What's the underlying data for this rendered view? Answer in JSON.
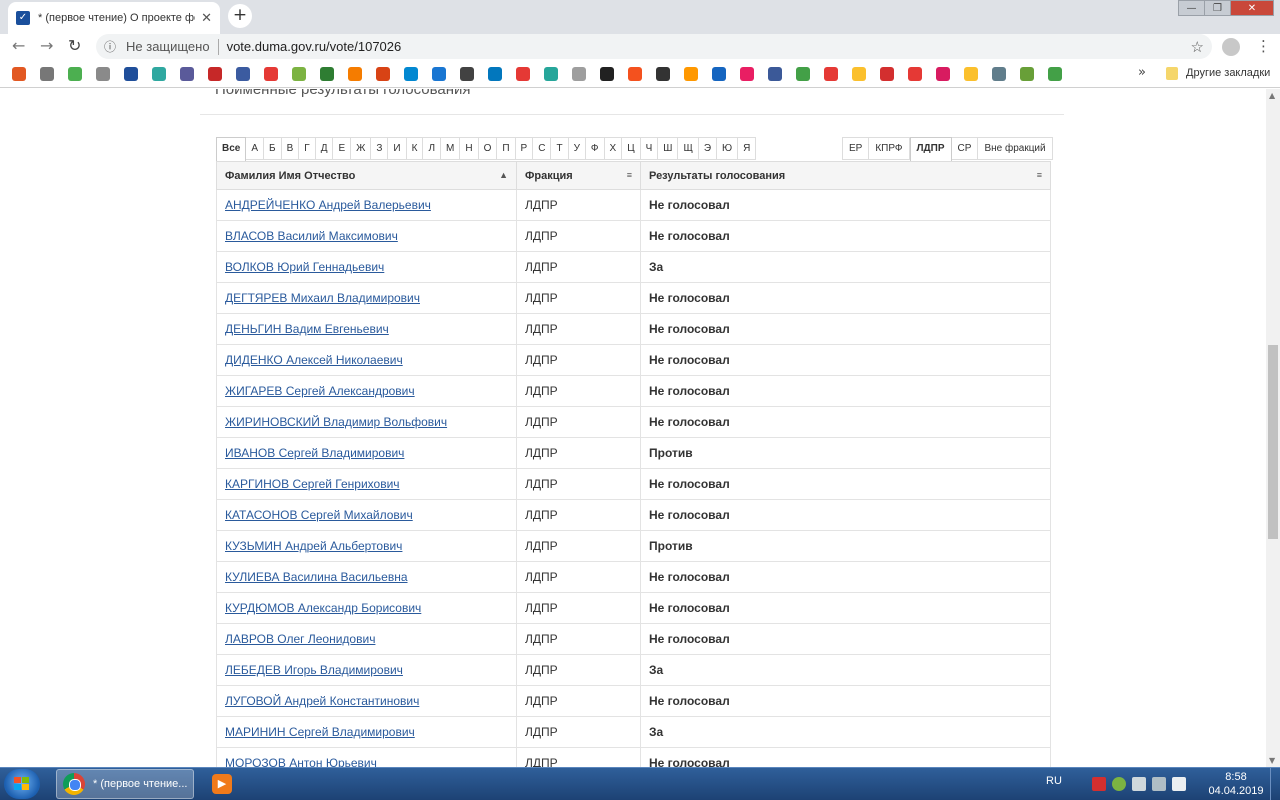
{
  "browser": {
    "tab_title": "* (первое чтение) О проекте фе",
    "tab_close": "✕",
    "new_tab": "+",
    "security_label": "Не защищено",
    "url": "vote.duma.gov.ru/vote/107026",
    "bookmarks_more": "»",
    "other_bookmarks": "Другие закладки",
    "bookmark_colors": [
      "#e25822",
      "#777777",
      "#4caf50",
      "#8a8a8a",
      "#1f4e9a",
      "#2fa8a0",
      "#5a5a9a",
      "#c62828",
      "#3b5ba0",
      "#e53935",
      "#7cb342",
      "#2e7d32",
      "#f57c00",
      "#d84315",
      "#0288d1",
      "#1976d2",
      "#424242",
      "#0277bd",
      "#e53935",
      "#26a69a",
      "#9e9e9e",
      "#212121",
      "#f4511e",
      "#333333",
      "#ff9800",
      "#1565c0",
      "#e91e63",
      "#3b5998",
      "#43a047",
      "#e53935",
      "#fbc02d",
      "#d32f2f",
      "#e53935",
      "#d81b60",
      "#fbc02d",
      "#607d8b",
      "#689f38",
      "#43a047"
    ]
  },
  "page": {
    "section_title": "Поименные результаты голосования",
    "letters": [
      "Все",
      "А",
      "Б",
      "В",
      "Г",
      "Д",
      "Е",
      "Ж",
      "З",
      "И",
      "К",
      "Л",
      "М",
      "Н",
      "О",
      "П",
      "Р",
      "С",
      "Т",
      "У",
      "Ф",
      "Х",
      "Ц",
      "Ч",
      "Ш",
      "Щ",
      "Э",
      "Ю",
      "Я"
    ],
    "active_letter": "Все",
    "factions": [
      "ЕР",
      "КПРФ",
      "ЛДПР",
      "СР",
      "Вне фракций"
    ],
    "active_faction": "ЛДПР",
    "table": {
      "headers": [
        "Фамилия Имя Отчество",
        "Фракция",
        "Результаты голосования"
      ],
      "sort_icon": "▲",
      "menu_icon": "≡",
      "rows": [
        {
          "name": "АНДРЕЙЧЕНКО Андрей Валерьевич",
          "faction": "ЛДПР",
          "vote": "Не голосовал",
          "kind": "none"
        },
        {
          "name": "ВЛАСОВ Василий Максимович",
          "faction": "ЛДПР",
          "vote": "Не голосовал",
          "kind": "none"
        },
        {
          "name": "ВОЛКОВ Юрий Геннадьевич",
          "faction": "ЛДПР",
          "vote": "За",
          "kind": "za"
        },
        {
          "name": "ДЕГТЯРЕВ Михаил Владимирович",
          "faction": "ЛДПР",
          "vote": "Не голосовал",
          "kind": "none"
        },
        {
          "name": "ДЕНЬГИН Вадим Евгеньевич",
          "faction": "ЛДПР",
          "vote": "Не голосовал",
          "kind": "none"
        },
        {
          "name": "ДИДЕНКО Алексей Николаевич",
          "faction": "ЛДПР",
          "vote": "Не голосовал",
          "kind": "none"
        },
        {
          "name": "ЖИГАРЕВ Сергей Александрович",
          "faction": "ЛДПР",
          "vote": "Не голосовал",
          "kind": "none"
        },
        {
          "name": "ЖИРИНОВСКИЙ Владимир Вольфович",
          "faction": "ЛДПР",
          "vote": "Не голосовал",
          "kind": "none"
        },
        {
          "name": "ИВАНОВ Сергей Владимирович",
          "faction": "ЛДПР",
          "vote": "Против",
          "kind": "protiv"
        },
        {
          "name": "КАРГИНОВ Сергей Генрихович",
          "faction": "ЛДПР",
          "vote": "Не голосовал",
          "kind": "none"
        },
        {
          "name": "КАТАСОНОВ Сергей Михайлович",
          "faction": "ЛДПР",
          "vote": "Не голосовал",
          "kind": "none"
        },
        {
          "name": "КУЗЬМИН Андрей Альбертович",
          "faction": "ЛДПР",
          "vote": "Против",
          "kind": "protiv"
        },
        {
          "name": "КУЛИЕВА Василина Васильевна",
          "faction": "ЛДПР",
          "vote": "Не голосовал",
          "kind": "none"
        },
        {
          "name": "КУРДЮМОВ Александр Борисович",
          "faction": "ЛДПР",
          "vote": "Не голосовал",
          "kind": "none"
        },
        {
          "name": "ЛАВРОВ Олег Леонидович",
          "faction": "ЛДПР",
          "vote": "Не голосовал",
          "kind": "none"
        },
        {
          "name": "ЛЕБЕДЕВ Игорь Владимирович",
          "faction": "ЛДПР",
          "vote": "За",
          "kind": "za"
        },
        {
          "name": "ЛУГОВОЙ Андрей Константинович",
          "faction": "ЛДПР",
          "vote": "Не голосовал",
          "kind": "none"
        },
        {
          "name": "МАРИНИН Сергей Владимирович",
          "faction": "ЛДПР",
          "vote": "За",
          "kind": "za"
        },
        {
          "name": "МОРОЗОВ Антон Юрьевич",
          "faction": "ЛДПР",
          "vote": "Не голосовал",
          "kind": "none"
        }
      ]
    }
  },
  "taskbar": {
    "chrome_label": "* (первое чтение...",
    "language": "RU",
    "time": "8:58",
    "date": "04.04.2019"
  }
}
